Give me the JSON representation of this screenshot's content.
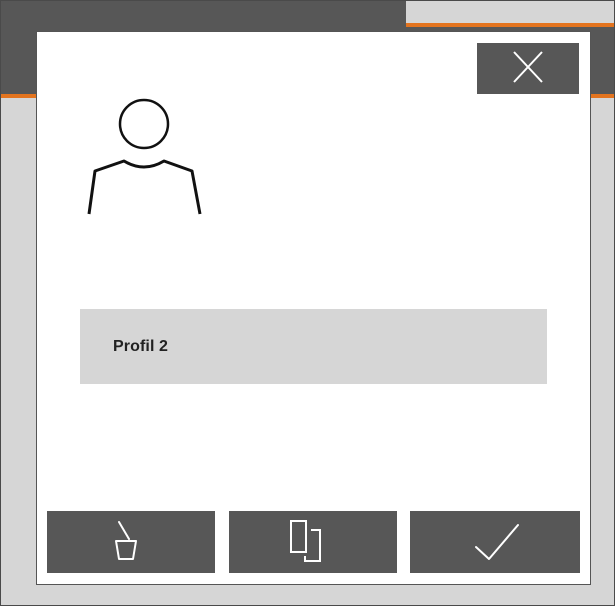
{
  "dialog": {
    "close_icon": "close-icon",
    "avatar_icon": "user-profile-icon",
    "profile_name": "Profil 2",
    "actions": [
      {
        "icon": "delete-icon"
      },
      {
        "icon": "copy-icon"
      },
      {
        "icon": "checkmark-icon"
      }
    ]
  },
  "colors": {
    "header": "#575757",
    "accent": "#e3741f",
    "field": "#d6d6d6",
    "button": "#575757",
    "icon_stroke": "#ffffff"
  }
}
